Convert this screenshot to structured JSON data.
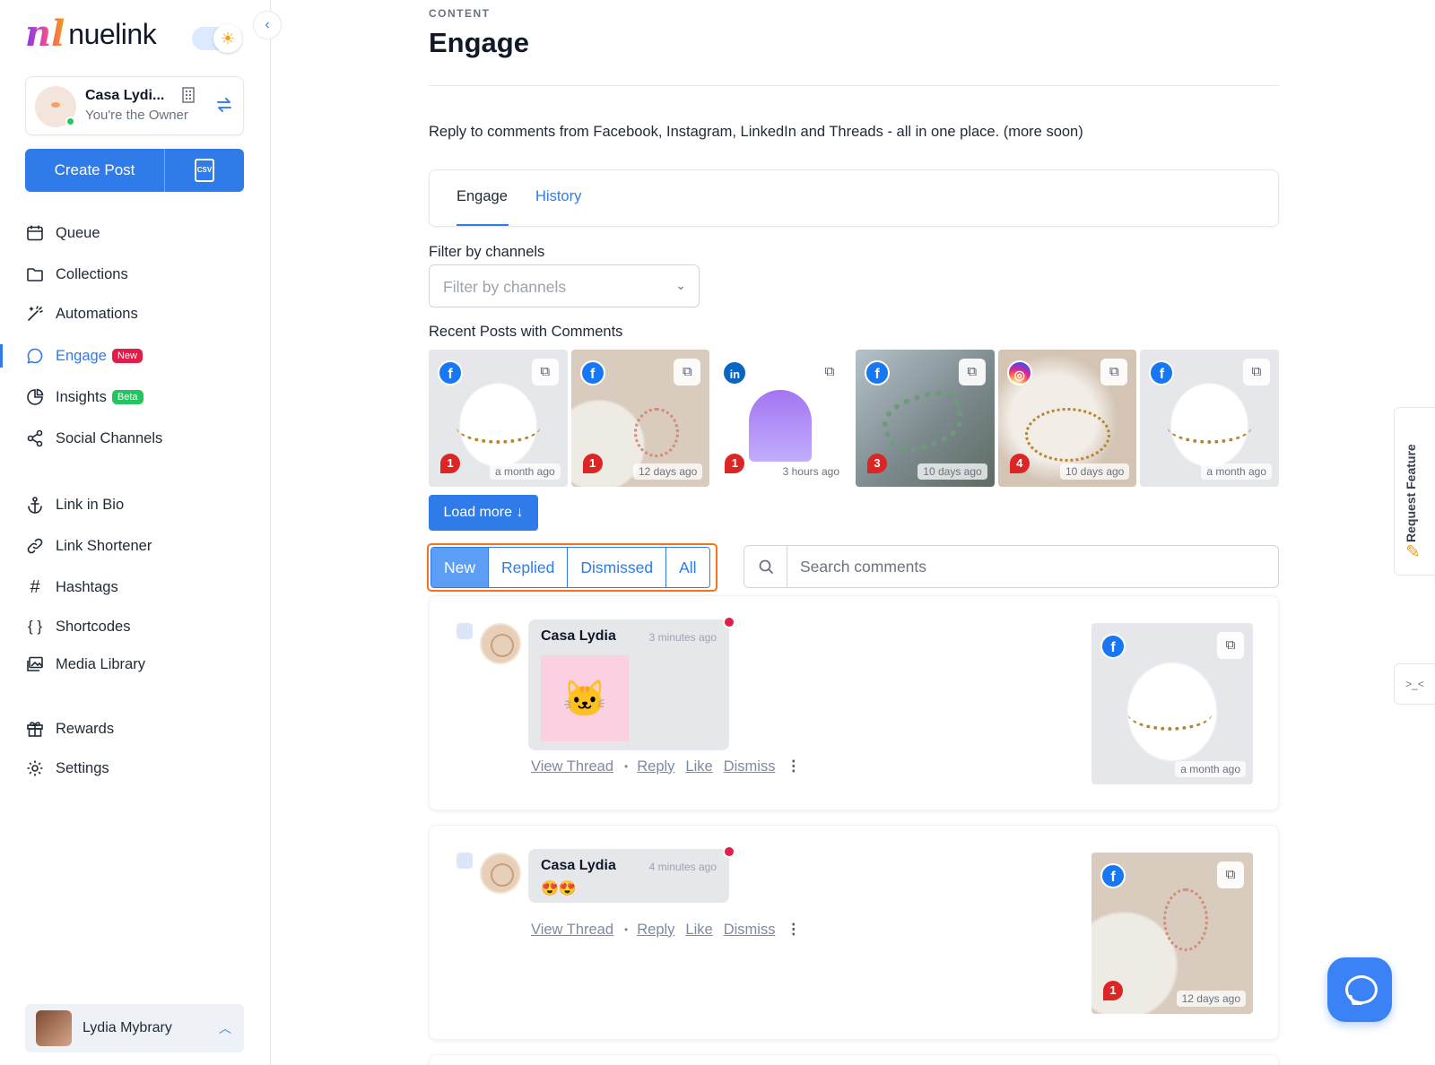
{
  "app": {
    "logo_text": "nuelink"
  },
  "account": {
    "name": "Casa Lydi...",
    "role": "You're the Owner"
  },
  "create": {
    "label": "Create Post",
    "csv_label": "CSV"
  },
  "nav": {
    "queue": "Queue",
    "collections": "Collections",
    "automations": "Automations",
    "engage": "Engage",
    "engage_badge": "New",
    "insights": "Insights",
    "insights_badge": "Beta",
    "social_channels": "Social Channels",
    "link_in_bio": "Link in Bio",
    "link_shortener": "Link Shortener",
    "hashtags": "Hashtags",
    "shortcodes": "Shortcodes",
    "media_library": "Media Library",
    "rewards": "Rewards",
    "settings": "Settings"
  },
  "user": {
    "name": "Lydia Mybrary"
  },
  "page": {
    "breadcrumb": "CONTENT",
    "title": "Engage",
    "description": "Reply to comments from Facebook, Instagram, LinkedIn and Threads - all in one place. (more soon)"
  },
  "tabs": {
    "engage": "Engage",
    "history": "History"
  },
  "filter": {
    "label": "Filter by channels",
    "placeholder": "Filter by channels"
  },
  "recent": {
    "label": "Recent Posts with Comments",
    "posts": [
      {
        "network": "facebook",
        "count": "1",
        "age": "a month ago"
      },
      {
        "network": "facebook",
        "count": "1",
        "age": "12 days ago"
      },
      {
        "network": "linkedin",
        "count": "1",
        "age": "3 hours ago"
      },
      {
        "network": "facebook",
        "count": "3",
        "age": "10 days ago"
      },
      {
        "network": "instagram",
        "count": "4",
        "age": "10 days ago"
      },
      {
        "network": "facebook",
        "count": "",
        "age": "a month ago"
      }
    ],
    "load_more": "Load more"
  },
  "status_filter": {
    "new": "New",
    "replied": "Replied",
    "dismissed": "Dismissed",
    "all": "All",
    "selected": "New"
  },
  "search": {
    "placeholder": "Search comments"
  },
  "comments": [
    {
      "author": "Casa Lydia",
      "time": "3 minutes ago",
      "content": "sticker",
      "post_age": "a month ago",
      "post_count": ""
    },
    {
      "author": "Casa Lydia",
      "time": "4 minutes ago",
      "content": "😍😍",
      "post_age": "12 days ago",
      "post_count": "1"
    }
  ],
  "comment_actions": {
    "view_thread": "View Thread",
    "reply": "Reply",
    "like": "Like",
    "dismiss": "Dismiss"
  },
  "feature_tab": {
    "label": "Request Feature"
  },
  "colors": {
    "accent": "#2f7be9",
    "highlight_outline": "#f97316",
    "badge_new": "#e11d48",
    "badge_beta": "#22c55e"
  }
}
